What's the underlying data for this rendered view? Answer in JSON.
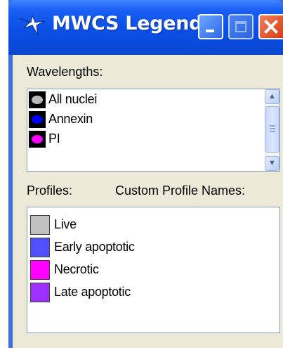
{
  "window": {
    "title": "MWCS Legend"
  },
  "wavelengths": {
    "label": "Wavelengths:",
    "items": [
      {
        "name": "All nuclei",
        "color": "#b8b8b8"
      },
      {
        "name": "Annexin",
        "color": "#0000ff"
      },
      {
        "name": "PI",
        "color": "#ff00ff"
      }
    ]
  },
  "profiles": {
    "label": "Profiles:",
    "custom_label": "Custom Profile Names:",
    "items": [
      {
        "name": "Live",
        "color": "#c0c0c0"
      },
      {
        "name": "Early apoptotic",
        "color": "#5050ff"
      },
      {
        "name": "Necrotic",
        "color": "#ff00ff"
      },
      {
        "name": "Late apoptotic",
        "color": "#9b30ff"
      }
    ]
  },
  "icons": {
    "app": "molecule-icon",
    "minimize": "minimize-icon",
    "maximize": "maximize-icon",
    "close": "close-icon",
    "scroll_up": "chevron-up-icon",
    "scroll_down": "chevron-down-icon"
  }
}
